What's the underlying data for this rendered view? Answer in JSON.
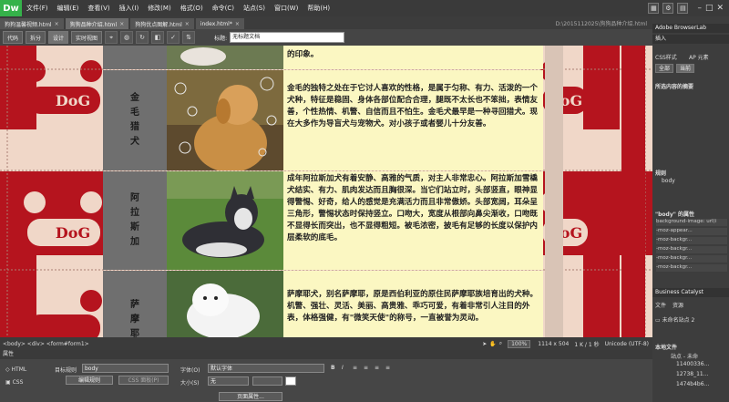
{
  "app": {
    "logo": "Dw"
  },
  "menus": [
    "文件(F)",
    "编辑(E)",
    "查看(V)",
    "插入(I)",
    "修改(M)",
    "格式(O)",
    "命令(C)",
    "站点(S)",
    "窗口(W)",
    "帮助(H)"
  ],
  "tabs": [
    {
      "label": "狗狗温馨视频.html",
      "active": false
    },
    {
      "label": "狗狗品种介绍.html",
      "active": true
    },
    {
      "label": "狗狗优点图解.html",
      "active": false
    },
    {
      "label": "index.html*",
      "active": false
    }
  ],
  "path_text": "D:\\2015112025\\狗狗品种介绍.html",
  "toolbar": {
    "views": [
      "代码",
      "拆分",
      "设计",
      "实时视图"
    ],
    "title_label": "标题:",
    "title_value": "无标题文档"
  },
  "dog_logo_text": "DoG",
  "content": {
    "top_fragment": "的印象。",
    "rows": [
      {
        "name": "金毛猎犬",
        "text": "金毛的独特之处在于它讨人喜欢的性格，是属于匀称、有力、活泼的一个犬种，特征是稳固、身体各部位配合合理，腿既不太长也不笨拙，表情友善，个性热情、机警、自信而且不怕生。金毛犬最早是一种寻回猎犬。现在大多作为导盲犬与宠物犬。对小孩子或者婴儿十分友善。"
      },
      {
        "name": "阿拉斯加",
        "text": "成年阿拉斯加犬有着安静、高雅的气质，对主人非常忠心。阿拉斯加雪橇犬结实、有力、肌肉发达而且胸很深。当它们站立时，头部竖直，眼神显得警惕、好奇，给人的感觉是充满活力而且非常傲娇。头部宽阔，耳朵呈三角形，警惕状态时保持竖立。口吻大，宽度从根部向鼻尖渐收，口吻既不显得长而突出，也不显得粗短。被毛浓密，披毛有足够的长度以保护内层柔软的底毛。"
      },
      {
        "name": "萨摩耶",
        "text": "萨摩耶犬，别名萨摩耶，原是西伯利亚的原住民萨摩耶族培育出的犬种。机警、强壮、灵活、美丽、高贵雅、乖巧可爱，有着非常引人注目的外表，体格强健，有\"微笑天使\"的称号，一直被誉为灵动。"
      }
    ]
  },
  "status": {
    "tags": "<body> <div> <form#form1>",
    "zoom": "100%",
    "dims": "1114 x 504",
    "size": "1 K / 1 秒",
    "encoding": "Unicode (UTF-8)"
  },
  "properties": {
    "header": "属性",
    "html_label": "HTML",
    "css_label": "CSS",
    "target_rule_label": "目标规则",
    "target_rule_value": "body",
    "edit_rule": "编辑规则",
    "css_panel": "CSS 面板(P)",
    "font_label": "字体(O)",
    "font_value": "默认字体",
    "size_label": "大小(S)",
    "size_value": "无",
    "page_props": "页面属性..."
  },
  "right_panel": {
    "top_title": "Adobe BrowserLab",
    "insert_tab": "插入",
    "css_tabs": [
      "CSS样式",
      "AP 元素"
    ],
    "mode_buttons": [
      "全部",
      "当前"
    ],
    "summary_title": "所选内容的摘要",
    "rules_label": "规则",
    "rules_value": "body",
    "props_title": "\"body\" 的属性",
    "props_rows": [
      "background-image: url(i",
      "-moz-appear...",
      "-moz-backgr...",
      "-moz-backgr...",
      "-moz-backgr...",
      "-moz-backgr..."
    ],
    "bc_title": "Business Catalyst",
    "files_tabs": [
      "文件",
      "资源"
    ],
    "site_label": "未命名站点 2",
    "local_files_label": "本地文件",
    "file_items": [
      "站点 - 未命",
      "11400336...",
      "12738_11...",
      "1474b4b6..."
    ]
  },
  "colors": {
    "accent_red": "#b5141e",
    "tile_bg": "#f0d7c8",
    "text_bg": "#fbf7c2"
  }
}
